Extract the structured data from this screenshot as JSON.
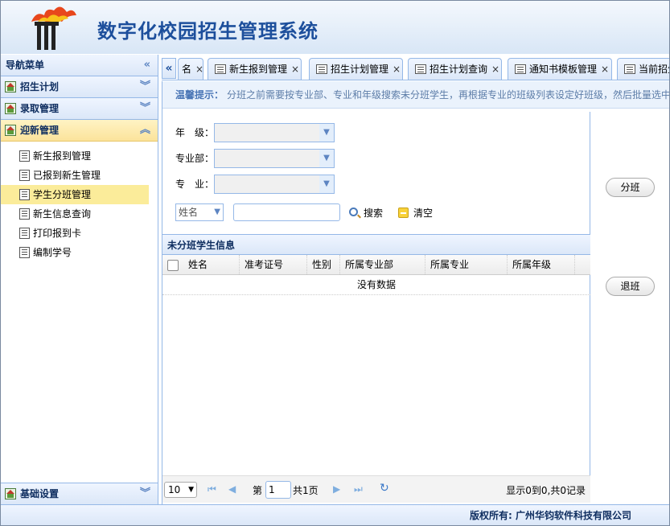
{
  "header": {
    "title": "数字化校园招生管理系统"
  },
  "sidebar": {
    "title": "导航菜单",
    "collapse_icon": "double-chevron-left-icon",
    "sections": [
      {
        "label": "招生计划",
        "expanded": false
      },
      {
        "label": "录取管理",
        "expanded": false
      },
      {
        "label": "迎新管理",
        "expanded": true
      }
    ],
    "items": [
      {
        "label": "新生报到管理",
        "active": false
      },
      {
        "label": "已报到新生管理",
        "active": false
      },
      {
        "label": "学生分班管理",
        "active": true
      },
      {
        "label": "新生信息查询",
        "active": false
      },
      {
        "label": "打印报到卡",
        "active": false
      },
      {
        "label": "编制学号",
        "active": false
      }
    ],
    "bottom_section": {
      "label": "基础设置"
    }
  },
  "tabs": [
    {
      "label": "名"
    },
    {
      "label": "新生报到管理"
    },
    {
      "label": "招生计划管理"
    },
    {
      "label": "招生计划查询"
    },
    {
      "label": "通知书模板管理"
    },
    {
      "label": "当前招生"
    }
  ],
  "tip": {
    "label": "温馨提示：",
    "text": "分班之前需要按专业部、专业和年级搜索未分班学生，再根据专业的班级列表设定好班级，然后批量选中"
  },
  "filters": {
    "grade_label": "年　级：",
    "dept_label": "专业部：",
    "major_label": "专　业：",
    "name_select": "姓名",
    "search_label": "搜索",
    "clear_label": "清空"
  },
  "grid": {
    "title": "未分班学生信息",
    "columns": [
      "姓名",
      "准考证号",
      "性别",
      "所属专业部",
      "所属专业",
      "所属年级"
    ],
    "empty_text": "没有数据"
  },
  "pager": {
    "page_size": "10",
    "page_prefix": "第",
    "page_value": "1",
    "page_suffix": "共1页",
    "summary": "显示0到0,共0记录"
  },
  "actions": {
    "assign_label": "分班",
    "withdraw_label": "退班"
  },
  "footer": {
    "text": "版权所有: 广州华钧软件科技有限公司"
  }
}
